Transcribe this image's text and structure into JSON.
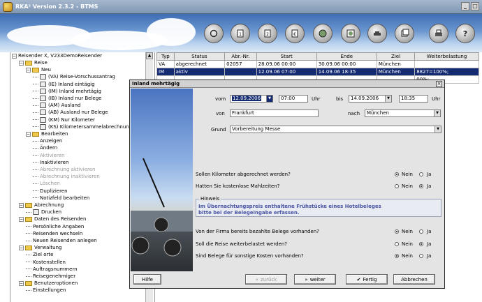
{
  "app": {
    "title": "RKA² Version 2.3.2 - BTMS",
    "window_buttons": [
      "_",
      "□"
    ]
  },
  "toolbar": {
    "icons": [
      "refresh-icon",
      "doc1-icon",
      "doc2-icon",
      "euro-icon",
      "globe-icon",
      "world-icon",
      "car-icon",
      "stack-icon",
      "printer-icon",
      "help-icon"
    ],
    "help_label": "?"
  },
  "tree": {
    "root": "Reisender X, V233DemoReisender",
    "items": [
      {
        "label": "Reise",
        "level": 1,
        "type": "folder",
        "exp": "−"
      },
      {
        "label": "Neu",
        "level": 2,
        "type": "folder",
        "exp": "−"
      },
      {
        "label": "(VA) Reise-Vorschussantrag",
        "level": 3,
        "type": "icon"
      },
      {
        "label": "(IE) Inland eintägig",
        "level": 3,
        "type": "icon"
      },
      {
        "label": "(IM) Inland mehrtägig",
        "level": 3,
        "type": "icon"
      },
      {
        "label": "(IB) Inland nur Belege",
        "level": 3,
        "type": "icon"
      },
      {
        "label": "(AM) Ausland",
        "level": 3,
        "type": "icon"
      },
      {
        "label": "(AB) Ausland nur Belege",
        "level": 3,
        "type": "icon"
      },
      {
        "label": "(KM) Nur Kilometer",
        "level": 3,
        "type": "icon"
      },
      {
        "label": "(KS) Kilometersammelabrechnung",
        "level": 3,
        "type": "icon"
      },
      {
        "label": "Bearbeiten",
        "level": 2,
        "type": "folder",
        "exp": "−"
      },
      {
        "label": "Anzeigen",
        "level": 3,
        "type": "dash"
      },
      {
        "label": "Ändern",
        "level": 3,
        "type": "dash"
      },
      {
        "label": "Aktivieren",
        "level": 3,
        "type": "dash",
        "disabled": true
      },
      {
        "label": "Inaktivieren",
        "level": 3,
        "type": "dash"
      },
      {
        "label": "Abrechnung aktivieren",
        "level": 3,
        "type": "dash",
        "disabled": true
      },
      {
        "label": "Abrechnung inaktivieren",
        "level": 3,
        "type": "dash",
        "disabled": true
      },
      {
        "label": "Löschen",
        "level": 3,
        "type": "dash",
        "disabled": true
      },
      {
        "label": "Duplizieren",
        "level": 3,
        "type": "dash"
      },
      {
        "label": "Notizfeld bearbeiten",
        "level": 3,
        "type": "dash"
      },
      {
        "label": "Abrechnung",
        "level": 1,
        "type": "folder",
        "exp": "−"
      },
      {
        "label": "Drucken",
        "level": 2,
        "type": "icon"
      },
      {
        "label": "Daten des Reisenden",
        "level": 1,
        "type": "folder",
        "exp": "−"
      },
      {
        "label": "Persönliche Angaben",
        "level": 2,
        "type": "dash"
      },
      {
        "label": "Reisenden wechseln",
        "level": 2,
        "type": "dash"
      },
      {
        "label": "Neuen Reisenden anlegen",
        "level": 2,
        "type": "dash"
      },
      {
        "label": "Verwaltung",
        "level": 1,
        "type": "folder",
        "exp": "−"
      },
      {
        "label": "Ziel orte",
        "level": 2,
        "type": "dash"
      },
      {
        "label": "Kostenstellen",
        "level": 2,
        "type": "dash"
      },
      {
        "label": "Auftragsnummern",
        "level": 2,
        "type": "dash"
      },
      {
        "label": "Reisegenehmiger",
        "level": 2,
        "type": "dash"
      },
      {
        "label": "Benutzeroptionen",
        "level": 1,
        "type": "folder",
        "exp": "−"
      },
      {
        "label": "Einstellungen",
        "level": 2,
        "type": "dash"
      }
    ]
  },
  "grid": {
    "headers": [
      "Typ",
      "Status",
      "Abr.-Nr.",
      "Start",
      "Ende",
      "Ziel",
      "Weiterbelastung"
    ],
    "rows": [
      [
        "VA",
        "abgerechnet",
        "02057",
        "28.09.06 00:00",
        "30.09.06 00:00",
        "München",
        ""
      ],
      [
        "IM",
        "aktiv",
        "",
        "12.09.06 07:00",
        "14.09.06 18:35",
        "München",
        "8827=100%;"
      ],
      [
        "",
        "",
        "",
        "",
        "",
        "",
        "00%;"
      ]
    ]
  },
  "dialog": {
    "title": "Inland mehrtägig",
    "close": "×",
    "vom_label": "vom",
    "vom_date": "12.09.2006",
    "vom_time": "07:00",
    "uhr1": "Uhr",
    "bis_label": "bis",
    "bis_date": "14.09.2006",
    "bis_time": "18:35",
    "uhr2": "Uhr",
    "von_label": "von",
    "von_value": "Frankfurt",
    "nach_label": "nach",
    "nach_value": "München",
    "grund_label": "Grund",
    "grund_value": "Vorbereitung Messe",
    "q1": "Sollen Kilometer abgerechnet werden?",
    "q2": "Hatten Sie kostenlose Mahlzeiten?",
    "hint_caption": "Hinweis",
    "hint_line1": "Im Übernachtungspreis enthaltene Frühstücke eines Hotelbeleges",
    "hint_line2": "bitte bei der Belegeingabe erfassen.",
    "q3": "Von der Firma bereits bezahlte Belege vorhanden?",
    "q4": "Soll die Reise weiterbelastet werden?",
    "q5": "Sind Belege für sonstige Kosten vorhanden?",
    "nein": "Nein",
    "ja": "Ja",
    "answers": [
      "Nein",
      "Ja",
      "Nein",
      "Ja",
      "Nein"
    ],
    "btn_hilfe": "Hilfe",
    "btn_zurueck": "zurück",
    "btn_weiter": "weiter",
    "btn_fertig": "Fertig",
    "btn_abbrechen": "Abbrechen"
  }
}
